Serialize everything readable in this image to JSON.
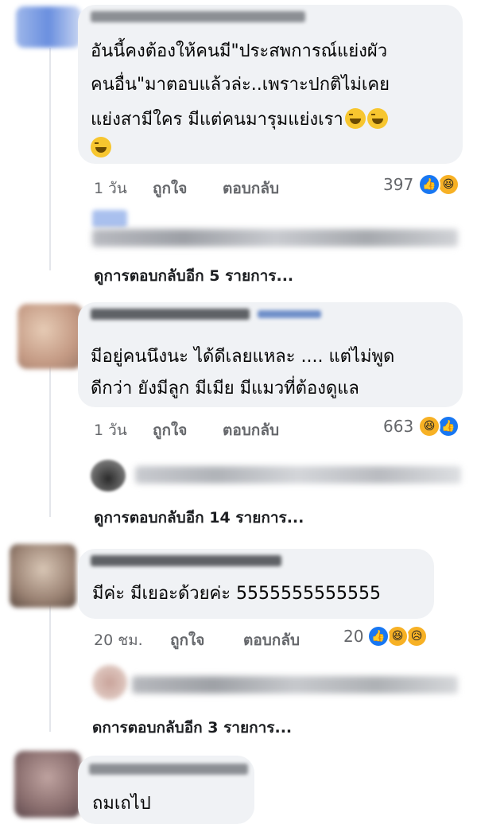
{
  "comments": [
    {
      "lines": [
        "อันนี้คงต้องให้คนมี\"ประสพการณ์แย่งผัว",
        "คนอื่น\"มาตอบแล้วล่ะ..เพราะปกติไม่เคย",
        "แย่งสามีใคร มีแต่คนมารุมแย่งเรา"
      ],
      "time": "1 วัน",
      "like_label": "ถูกใจ",
      "reply_label": "ตอบกลับ",
      "reaction_count": "397",
      "reactions": [
        "like-icon",
        "haha-icon"
      ],
      "more_replies": "ดูการตอบกลับอีก 5 รายการ..."
    },
    {
      "lines": [
        "มีอยู่คนนึงนะ ได้ดีเลยแหละ .... แต่ไม่พูด",
        "ดีกว่า ยังมีลูก มีเมีย มีแมวที่ต้องดูแล"
      ],
      "time": "1 วัน",
      "like_label": "ถูกใจ",
      "reply_label": "ตอบกลับ",
      "reaction_count": "663",
      "reactions": [
        "haha-icon",
        "like-icon"
      ],
      "more_replies": "ดูการตอบกลับอีก 14 รายการ..."
    },
    {
      "lines": [
        "มีค่ะ มีเยอะด้วยค่ะ 5555555555555"
      ],
      "time": "20 ชม.",
      "like_label": "ถูกใจ",
      "reply_label": "ตอบกลับ",
      "reaction_count": "20",
      "reactions": [
        "like-icon",
        "haha-icon",
        "sad-icon"
      ],
      "more_replies": "ดการตอบกลับอีก 3 รายการ..."
    },
    {
      "lines": [
        "ถมเถไป"
      ]
    }
  ],
  "colors": {
    "bubble": "#f0f2f5",
    "meta": "#65676b",
    "like": "#1877f2",
    "haha": "#f7b125"
  }
}
